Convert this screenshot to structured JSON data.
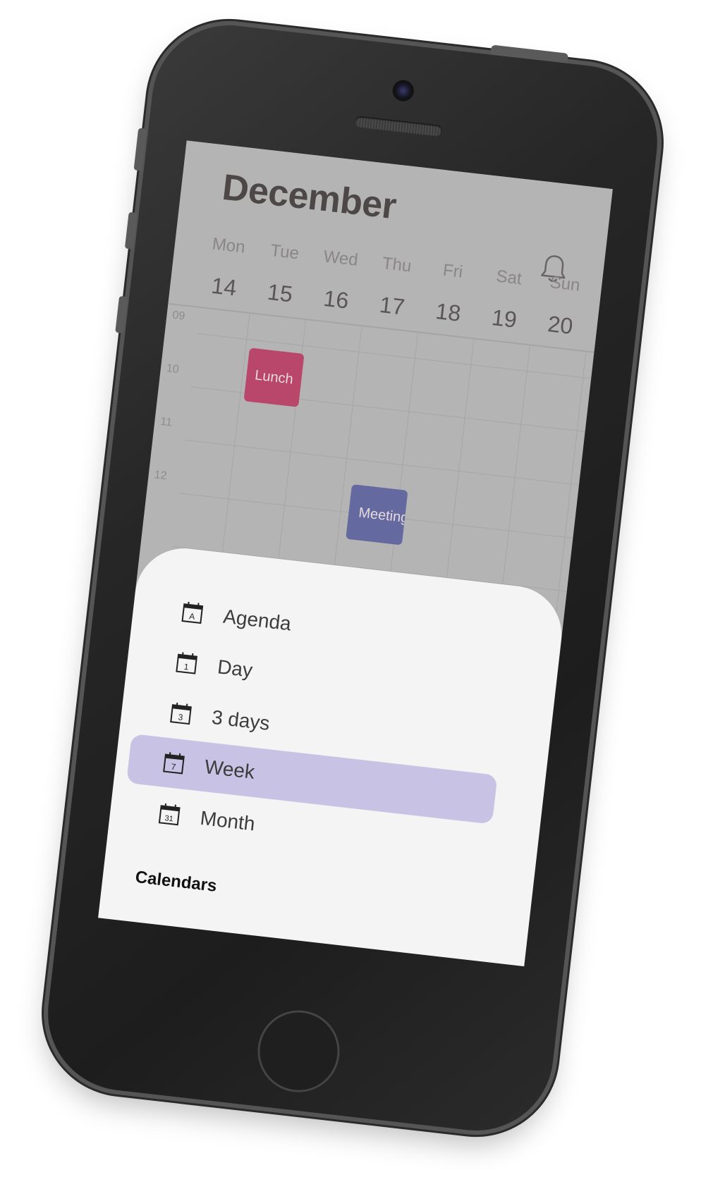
{
  "calendar": {
    "month": "December",
    "days": [
      {
        "name": "Mon",
        "num": "14"
      },
      {
        "name": "Tue",
        "num": "15"
      },
      {
        "name": "Wed",
        "num": "16"
      },
      {
        "name": "Thu",
        "num": "17"
      },
      {
        "name": "Fri",
        "num": "18"
      },
      {
        "name": "Sat",
        "num": "19"
      },
      {
        "name": "Sun",
        "num": "20"
      }
    ],
    "hours": [
      "09",
      "10",
      "11",
      "12"
    ],
    "events": {
      "lunch": "Lunch",
      "meeting": "Meeting"
    }
  },
  "menu": {
    "items": [
      {
        "label": "Agenda",
        "icon": "A"
      },
      {
        "label": "Day",
        "icon": "1"
      },
      {
        "label": "3 days",
        "icon": "3"
      },
      {
        "label": "Week",
        "icon": "7"
      },
      {
        "label": "Month",
        "icon": "31"
      }
    ],
    "selected": "Week",
    "calendars_title": "Calendars"
  },
  "colors": {
    "overlay": "#b4b4b4",
    "lunch": "#b9476c",
    "meeting": "#646a9f",
    "selected_bg": "#c8c2e4",
    "sheet_bg": "#f4f4f4"
  },
  "icons": {
    "bell": "bell-icon",
    "calendar": "calendar-icon"
  }
}
